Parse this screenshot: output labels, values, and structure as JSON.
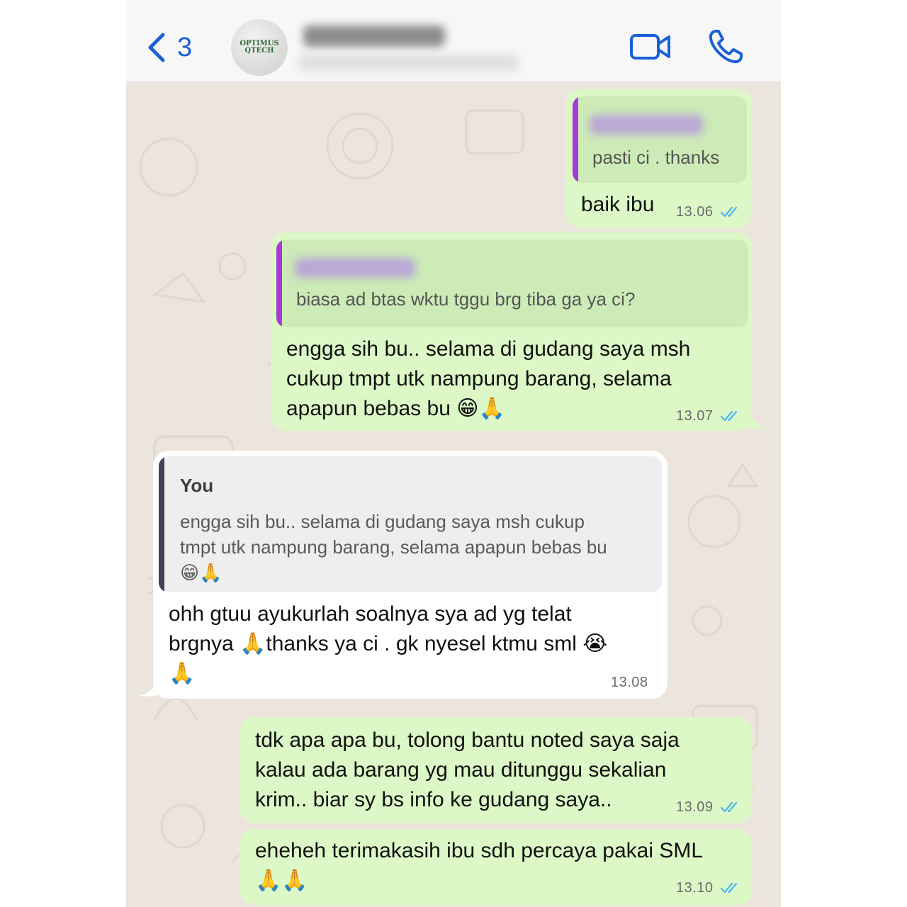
{
  "header": {
    "back_count": "3",
    "avatar_text": [
      "OPTIMUS",
      "QTECH"
    ]
  },
  "messages": [
    {
      "id": "m1",
      "direction": "outgoing",
      "quote_text": "pasti ci . thanks",
      "text": "baik ibu",
      "time": "13.06",
      "status": "read"
    },
    {
      "id": "m2",
      "direction": "outgoing",
      "quote_text": "biasa ad btas wktu tggu brg tiba ga ya ci?",
      "lines": [
        "engga sih bu.. selama di gudang saya msh",
        "cukup tmpt utk nampung barang, selama",
        "apapun bebas bu 😁🙏"
      ],
      "time": "13.07",
      "status": "read"
    },
    {
      "id": "m3",
      "direction": "incoming",
      "quote_sender": "You",
      "quote_lines": [
        "engga sih bu.. selama di gudang saya msh cukup",
        "tmpt utk nampung barang, selama apapun bebas bu",
        "😁🙏"
      ],
      "lines": [
        "ohh gtuu ayukurlah soalnya sya ad yg telat",
        "brgnya 🙏thanks ya ci . gk nyesel ktmu sml 😭",
        "🙏"
      ],
      "time": "13.08"
    },
    {
      "id": "m4",
      "direction": "outgoing",
      "lines": [
        "tdk apa apa bu, tolong bantu noted saya saja",
        "kalau ada barang yg mau ditunggu sekalian",
        "krim.. biar sy bs info ke gudang saya.."
      ],
      "time": "13.09",
      "status": "read"
    },
    {
      "id": "m5",
      "direction": "outgoing",
      "lines": [
        "eheheh terimakasih ibu sdh percaya pakai SML",
        "🙏🙏"
      ],
      "time": "13.10",
      "status": "read"
    }
  ],
  "colors": {
    "outgoing_bubble": "#dcf8c6",
    "incoming_bubble": "#ffffff",
    "chat_background": "#ece5dd",
    "accent_blue": "#1a5fd6",
    "read_ticks": "#4fb6ec",
    "quote_bar_out": "#a63ad6",
    "quote_bar_in": "#4a3f55"
  },
  "icons": {
    "back": "chevron-left-icon",
    "video": "video-camera-icon",
    "call": "phone-icon",
    "status": "double-check-icon"
  }
}
